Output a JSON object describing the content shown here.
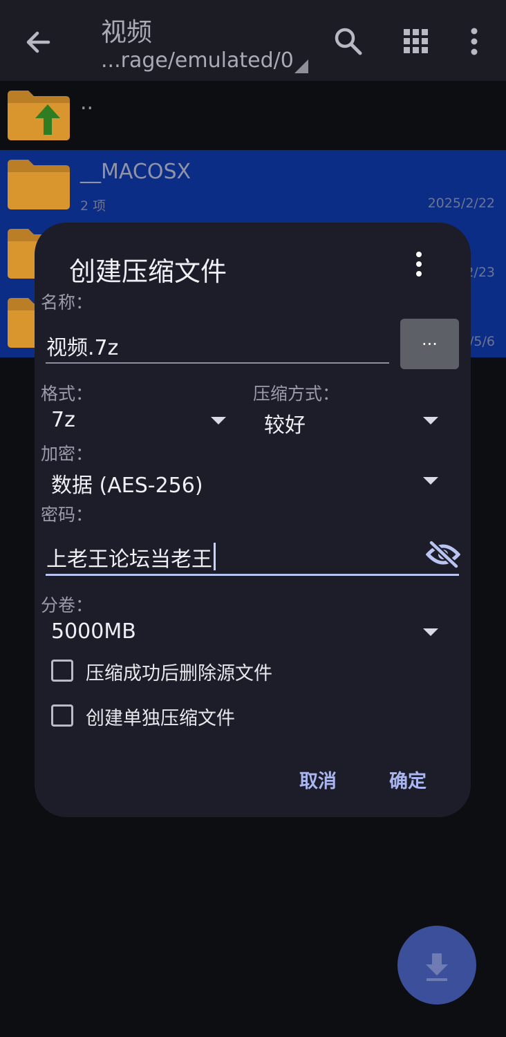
{
  "toolbar": {
    "title": "视频",
    "path": "...rage/emulated/0",
    "icons": [
      "back-arrow-icon",
      "search-icon",
      "grid-view-icon",
      "more-vertical-icon"
    ]
  },
  "files": [
    {
      "name": "..",
      "meta": "",
      "date": "",
      "icon": "folder-up-icon",
      "selected": false
    },
    {
      "name": "__MACOSX",
      "meta": "2 项",
      "date": "2025/2/22",
      "icon": "folder-icon",
      "selected": true
    },
    {
      "name": "",
      "meta": "",
      "date": "2/23",
      "icon": "folder-icon",
      "selected": true
    },
    {
      "name": "",
      "meta": "",
      "date": "/5/6",
      "icon": "folder-icon",
      "selected": true
    }
  ],
  "dialog": {
    "title": "创建压缩文件",
    "name_label": "名称：",
    "name_value": "视频.7z",
    "browse_label": "...",
    "format_label": "格式：",
    "format_value": "7z",
    "method_label": "压缩方式：",
    "method_value": "较好",
    "encrypt_label": "加密：",
    "encrypt_value": "数据 (AES-256)",
    "password_label": "密码：",
    "password_value": "上老王论坛当老王",
    "split_label": "分卷：",
    "split_value": "5000MB",
    "delete_source_label": "压缩成功后删除源文件",
    "delete_source_checked": false,
    "separate_archives_label": "创建单独压缩文件",
    "separate_archives_checked": false,
    "cancel_label": "取消",
    "ok_label": "确定"
  },
  "colors": {
    "selection": "#0b2d86",
    "dialog_bg": "#1c1d29",
    "accent": "#a9b6f0",
    "folder": "#e8a63a",
    "fab": "#3b4f9b"
  }
}
